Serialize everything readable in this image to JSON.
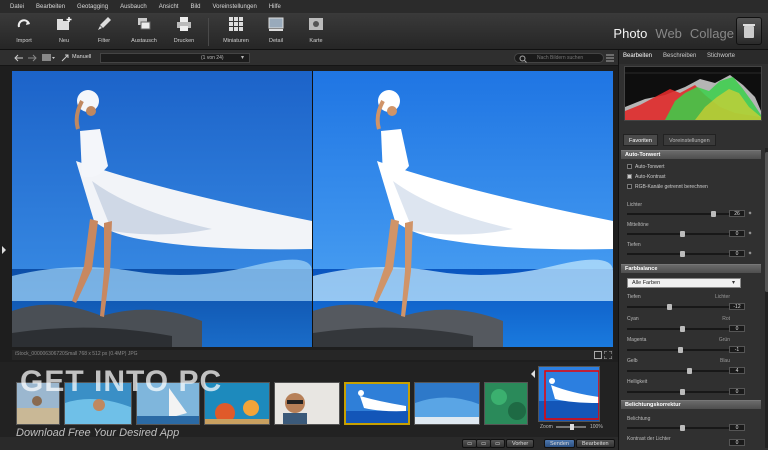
{
  "menu": [
    "Datei",
    "Bearbeiten",
    "Geotagging",
    "Ausbauch",
    "Ansicht",
    "Bild",
    "Voreinstellungen",
    "Hilfe"
  ],
  "toolbar": {
    "items": [
      {
        "label": "Import",
        "icon": "import-icon"
      },
      {
        "label": "Neu",
        "icon": "new-folder-icon"
      },
      {
        "label": "Filter",
        "icon": "filter-brush-icon"
      },
      {
        "label": "Austausch",
        "icon": "exchange-icon"
      },
      {
        "label": "Drucken",
        "icon": "print-icon"
      },
      {
        "label": "Miniaturen",
        "icon": "thumbnails-grid-icon"
      },
      {
        "label": "Detail",
        "icon": "detail-view-icon"
      },
      {
        "label": "Karte",
        "icon": "map-icon"
      }
    ],
    "modes": [
      "Photo",
      "Web",
      "Collage"
    ],
    "active_mode": "Photo"
  },
  "subtoolbar": {
    "sort_label": "Manuell",
    "position": "(1 von 24)",
    "search_placeholder": "Nach Bildern suchen"
  },
  "info": {
    "text": "iStock_000006306720Small   768 x 512 px   (0.4MP)   JPG"
  },
  "watermark": {
    "title": "GET INTO PC",
    "subtitle": "Download Free Your Desired App"
  },
  "bottom": {
    "zoom_label": "Zoom",
    "zoom_value": "100%",
    "buttons": [
      "Vorher",
      "Senden",
      "Bearbeiten"
    ]
  },
  "panel": {
    "tabs": [
      "Bearbeiten",
      "Beschreiben",
      "Stichworte"
    ],
    "active_tab": "Bearbeiten",
    "subtabs": [
      "Favoriten",
      "Voreinstellungen"
    ],
    "auto": {
      "title": "Auto-Tonwert",
      "checks": [
        "Auto-Tonwert",
        "Auto-Kontrast",
        "RGB-Kanäle getrennt berechnen"
      ],
      "checked": [
        false,
        true,
        false
      ],
      "sliders": [
        {
          "label": "Lichter",
          "value": "26",
          "pos": 0.78
        },
        {
          "label": "Mitteltöne",
          "value": "0",
          "pos": 0.5
        },
        {
          "label": "Tiefen",
          "value": "0",
          "pos": 0.5
        }
      ]
    },
    "farbbalance": {
      "title": "Farbbalance",
      "select": "Alle Farben",
      "rows": [
        {
          "left": "Tiefen",
          "right": "Lichter",
          "value": "-12",
          "pos": 0.38
        },
        {
          "left": "Cyan",
          "right": "Rot",
          "value": "0",
          "pos": 0.5
        },
        {
          "left": "Magenta",
          "right": "Grün",
          "value": "-1",
          "pos": 0.48
        },
        {
          "left": "Gelb",
          "right": "Blau",
          "value": "4",
          "pos": 0.56
        },
        {
          "left": "Helligkeit",
          "right": "",
          "value": "0",
          "pos": 0.5
        }
      ]
    },
    "belichtung": {
      "title": "Belichtungskorrektur",
      "rows": [
        {
          "label": "Belichtung",
          "value": "0",
          "pos": 0.5
        },
        {
          "label": "Kontrast der Lichter",
          "value": "0",
          "pos": 0.5
        }
      ]
    }
  },
  "colors": {
    "accent_blue": "#3a6bb0",
    "selection_gold": "#c8a000",
    "sky_top": "#1f6fd6",
    "sea": "#1356b8"
  }
}
